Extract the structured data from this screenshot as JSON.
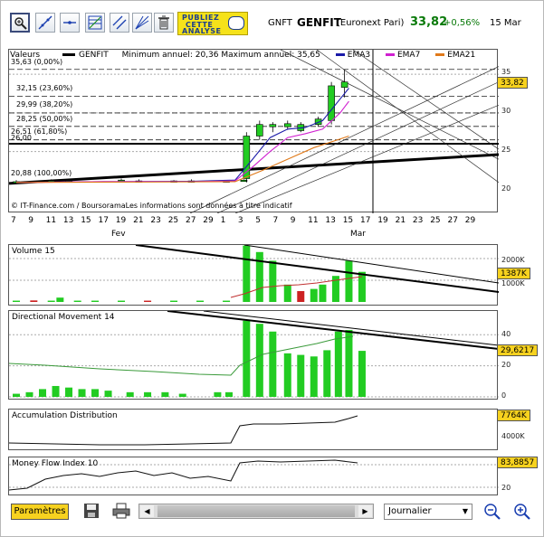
{
  "toolbar": {
    "tools": [
      {
        "name": "zoom-tool-icon"
      },
      {
        "name": "trendline-tool-icon"
      },
      {
        "name": "horizontal-line-tool-icon"
      },
      {
        "name": "fibonacci-tool-icon"
      },
      {
        "name": "parallel-lines-tool-icon"
      },
      {
        "name": "fan-tool-icon"
      },
      {
        "name": "trash-icon"
      }
    ],
    "ad_line1": "PUBLIEZ",
    "ad_line2": "CETTE",
    "ad_line3": "ANALYSE"
  },
  "header": {
    "ticker": "GNFT",
    "name": "GENFIT",
    "exchange": "(Euronext Pari)",
    "price": "33,82",
    "change": "+0,56%",
    "date": "15 Mar"
  },
  "main_chart": {
    "legend_label": "Valeurs",
    "legend_series": "GENFIT",
    "min_max": "Minimum annuel: 20,36 Maximum annuel: 35,65",
    "ema3": "EMA3",
    "ema7": "EMA7",
    "ema21": "EMA21",
    "fib_levels": [
      "35,63 (0,00%)",
      "32,15 (23,60%)",
      "29,99 (38,20%)",
      "28,25 (50,00%)",
      "26,51 (61,80%)",
      "26,00",
      "20,88 (100,00%)"
    ],
    "y_ticks": [
      "35",
      "30",
      "25",
      "20"
    ],
    "price_tag": "33,82",
    "credit": "© IT-Finance.com / BoursoramaLes informations sont données à titre indicatif",
    "x_ticks": [
      "7",
      "9",
      "11",
      "13",
      "15",
      "17",
      "19",
      "21",
      "23",
      "25",
      "27",
      "29",
      "1",
      "3",
      "5",
      "7",
      "9",
      "11",
      "13",
      "15",
      "17",
      "19",
      "21",
      "23",
      "25",
      "27",
      "29"
    ],
    "month_labels": [
      "Fev",
      "Mar"
    ]
  },
  "volume_panel": {
    "title": "Volume 15",
    "y_ticks": [
      "2000K",
      "1000K"
    ],
    "tag": "1387K"
  },
  "dm_panel": {
    "title": "Directional Movement 14",
    "y_ticks": [
      "40",
      "20",
      "0"
    ],
    "tag": "29,6217"
  },
  "ad_panel": {
    "title": "Accumulation Distribution",
    "y_ticks": [
      "4000K"
    ],
    "tag": "7764K"
  },
  "mfi_panel": {
    "title": "Money Flow Index 10",
    "y_ticks": [
      "20"
    ],
    "tag": "83,8857"
  },
  "bottom": {
    "params_label": "Paramètres",
    "period": "Journalier"
  },
  "colors": {
    "accent_yellow": "#f7d21f",
    "candle_green": "#22cc22",
    "ema3": "#1a1aa8",
    "ema7": "#d020d0",
    "ema21": "#e07a1a"
  }
}
